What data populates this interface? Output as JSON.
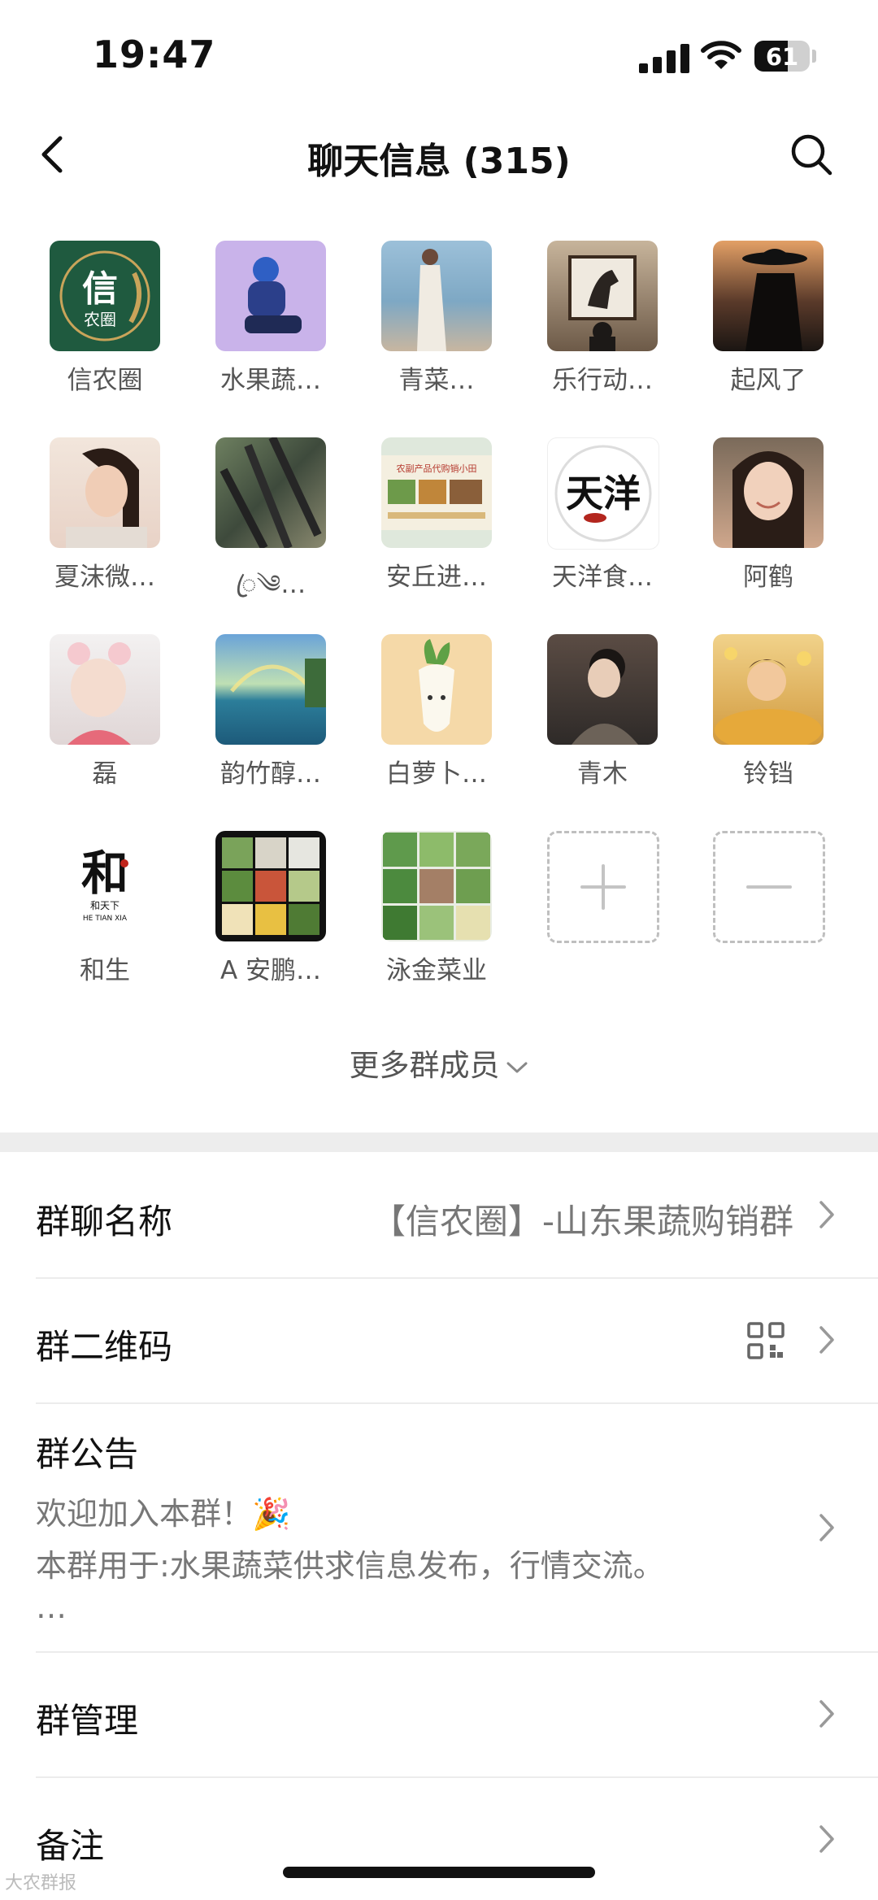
{
  "status_bar": {
    "time": "19:47",
    "battery": "61",
    "battery_level": 0.61
  },
  "nav": {
    "title": "聊天信息 (315)"
  },
  "members": [
    {
      "name": "信农圈",
      "avatar_text": "信",
      "avatar_sub": "农圈"
    },
    {
      "name": "水果蔬…"
    },
    {
      "name": "青菜…"
    },
    {
      "name": "乐行动…"
    },
    {
      "name": "起风了"
    },
    {
      "name": "夏沫微…"
    },
    {
      "name": "ꦿ༄…"
    },
    {
      "name": "安丘进…",
      "avatar_text": "农副产品代购销小田"
    },
    {
      "name": "天洋食…",
      "avatar_text": "天洋"
    },
    {
      "name": "阿鹤"
    },
    {
      "name": "磊"
    },
    {
      "name": "韵竹醇…"
    },
    {
      "name": "白萝卜…"
    },
    {
      "name": "青木"
    },
    {
      "name": "铃铛"
    },
    {
      "name": "和生",
      "avatar_text": "和",
      "avatar_sub": "和天下",
      "avatar_sub2": "HE TIAN XIA"
    },
    {
      "name": "A 安鹏…"
    },
    {
      "name": "泳金菜业"
    }
  ],
  "more_members": "更多群成员",
  "settings": {
    "group_name": {
      "label": "群聊名称",
      "value": "【信农圈】-山东果蔬购销群"
    },
    "qr_code": {
      "label": "群二维码"
    },
    "notice": {
      "label": "群公告",
      "line1": "欢迎加入本群！🎉",
      "line2": "本群用于:水果蔬菜供求信息发布，行情交流。",
      "line3": "…"
    },
    "manage": {
      "label": "群管理"
    },
    "remark": {
      "label": "备注"
    }
  },
  "watermark": "大农群报",
  "colors": {
    "background": "#ffffff",
    "divider": "#ececec",
    "section_gap": "#ededed",
    "secondary_text": "#777777"
  },
  "icons": [
    "back-chevron-icon",
    "search-icon",
    "chevron-down-icon",
    "qr-code-icon",
    "chevron-right-icon",
    "plus-icon",
    "minus-icon",
    "signal-icon",
    "wifi-icon",
    "battery-icon"
  ]
}
